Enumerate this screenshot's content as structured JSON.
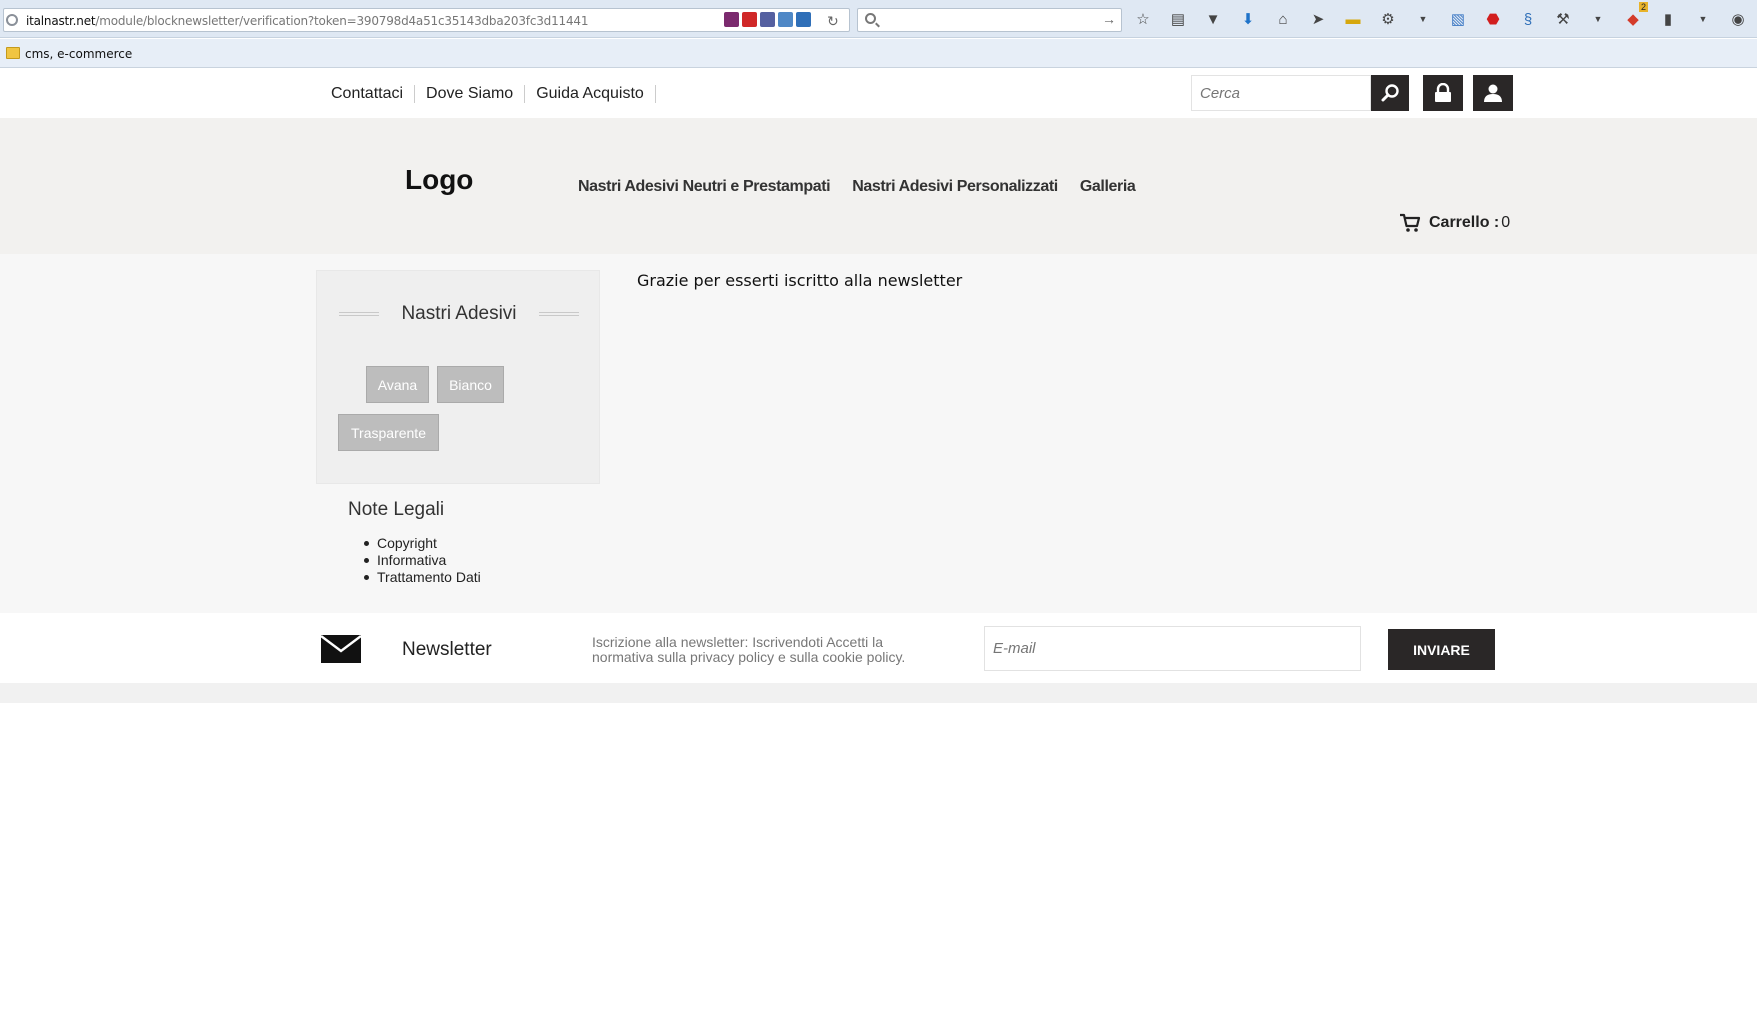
{
  "browser": {
    "url_host": "italnastr.net",
    "url_path": "/module/blocknewsletter/verification?token=390798d4a51c35143dba203fc3d11441",
    "bookmark": "cms, e-commerce",
    "addon_badge": "2"
  },
  "site": {
    "top_links": [
      "Contattaci",
      "Dove Siamo",
      "Guida Acquisto"
    ],
    "search_placeholder": "Cerca",
    "logo": "Logo",
    "nav": [
      "Nastri Adesivi Neutri e Prestampati",
      "Nastri Adesivi Personalizzati",
      "Galleria"
    ],
    "cart_label": "Carrello :",
    "cart_count": "0"
  },
  "sidebar": {
    "title": "Nastri Adesivi",
    "tags": [
      "Avana",
      "Bianco",
      "Trasparente"
    ]
  },
  "legal": {
    "title": "Note Legali",
    "items": [
      "Copyright",
      "Informativa",
      "Trattamento Dati"
    ]
  },
  "main": {
    "message": "Grazie per esserti iscritto alla newsletter"
  },
  "newsletter": {
    "title": "Newsletter",
    "description": "Iscrizione alla newsletter: Iscrivendoti Accetti la normativa sulla privacy policy e sulla cookie policy.",
    "email_placeholder": "E-mail",
    "send_label": "INVIARE"
  },
  "colors": {
    "dark_button": "#2a2727",
    "header_bg": "#f2f1ef",
    "tag_bg": "#bdbdbd"
  }
}
